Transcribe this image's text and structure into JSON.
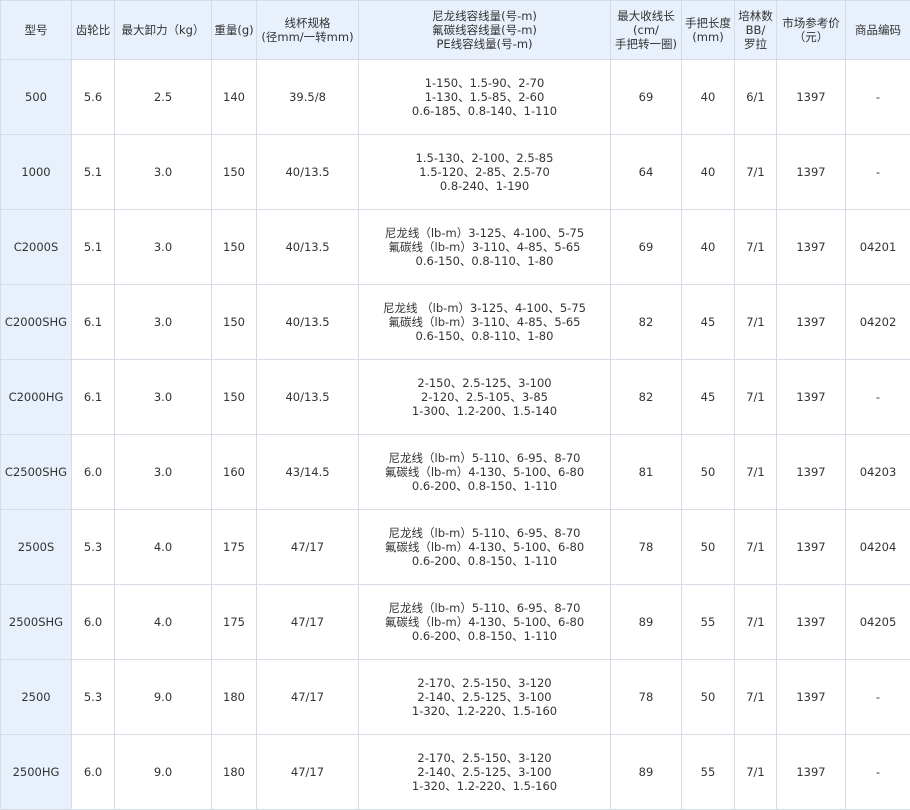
{
  "headers": [
    {
      "lines": [
        "型号"
      ]
    },
    {
      "lines": [
        "齿轮比"
      ]
    },
    {
      "lines": [
        "最大卸力（kg）"
      ]
    },
    {
      "lines": [
        "重量(g)"
      ]
    },
    {
      "lines": [
        "线杯规格",
        "(径mm/一转mm)"
      ]
    },
    {
      "lines": [
        "尼龙线容线量(号-m)",
        "氟碳线容线量(号-m)",
        "PE线容线量(号-m)"
      ]
    },
    {
      "lines": [
        "最大收线长",
        "(cm/",
        "手把转一圈)"
      ]
    },
    {
      "lines": [
        "手把长度",
        "(mm)"
      ]
    },
    {
      "lines": [
        "培林数",
        "BB/",
        "罗拉"
      ]
    },
    {
      "lines": [
        "市场参考价",
        "（元）"
      ]
    },
    {
      "lines": [
        "商品编码"
      ]
    }
  ],
  "rows": [
    {
      "model": "500",
      "gear_ratio": "5.6",
      "max_drag": "2.5",
      "weight": "140",
      "spool": "39.5/8",
      "capacity": [
        "1-150、1.5-90、2-70",
        "1-130、1.5-85、2-60",
        "0.6-185、0.8-140、1-110"
      ],
      "retrieve": "69",
      "handle": "40",
      "bearings": "6/1",
      "price": "1397",
      "code": "-"
    },
    {
      "model": "1000",
      "gear_ratio": "5.1",
      "max_drag": "3.0",
      "weight": "150",
      "spool": "40/13.5",
      "capacity": [
        "1.5-130、2-100、2.5-85",
        "1.5-120、2-85、2.5-70",
        "0.8-240、1-190"
      ],
      "retrieve": "64",
      "handle": "40",
      "bearings": "7/1",
      "price": "1397",
      "code": "-"
    },
    {
      "model": "C2000S",
      "gear_ratio": "5.1",
      "max_drag": "3.0",
      "weight": "150",
      "spool": "40/13.5",
      "capacity": [
        "尼龙线（lb-m）3-125、4-100、5-75",
        "氟碳线（lb-m）3-110、4-85、5-65",
        "0.6-150、0.8-110、1-80"
      ],
      "retrieve": "69",
      "handle": "40",
      "bearings": "7/1",
      "price": "1397",
      "code": "04201"
    },
    {
      "model": "C2000SHG",
      "gear_ratio": "6.1",
      "max_drag": "3.0",
      "weight": "150",
      "spool": "40/13.5",
      "capacity": [
        "尼龙线 （lb-m）3-125、4-100、5-75",
        "氟碳线（lb-m）3-110、4-85、5-65",
        "0.6-150、0.8-110、1-80"
      ],
      "retrieve": "82",
      "handle": "45",
      "bearings": "7/1",
      "price": "1397",
      "code": "04202"
    },
    {
      "model": "C2000HG",
      "gear_ratio": "6.1",
      "max_drag": "3.0",
      "weight": "150",
      "spool": "40/13.5",
      "capacity": [
        "2-150、2.5-125、3-100",
        "2-120、2.5-105、3-85",
        "1-300、1.2-200、1.5-140"
      ],
      "retrieve": "82",
      "handle": "45",
      "bearings": "7/1",
      "price": "1397",
      "code": "-"
    },
    {
      "model": "C2500SHG",
      "gear_ratio": "6.0",
      "max_drag": "3.0",
      "weight": "160",
      "spool": "43/14.5",
      "capacity": [
        "尼龙线（lb-m）5-110、6-95、8-70",
        "氟碳线（lb-m）4-130、5-100、6-80",
        "0.6-200、0.8-150、1-110"
      ],
      "retrieve": "81",
      "handle": "50",
      "bearings": "7/1",
      "price": "1397",
      "code": "04203"
    },
    {
      "model": "2500S",
      "gear_ratio": "5.3",
      "max_drag": "4.0",
      "weight": "175",
      "spool": "47/17",
      "capacity": [
        "尼龙线（lb-m）5-110、6-95、8-70",
        "氟碳线（lb-m）4-130、5-100、6-80",
        "0.6-200、0.8-150、1-110"
      ],
      "retrieve": "78",
      "handle": "50",
      "bearings": "7/1",
      "price": "1397",
      "code": "04204"
    },
    {
      "model": "2500SHG",
      "gear_ratio": "6.0",
      "max_drag": "4.0",
      "weight": "175",
      "spool": "47/17",
      "capacity": [
        "尼龙线（lb-m）5-110、6-95、8-70",
        "氟碳线（lb-m）4-130、5-100、6-80",
        "0.6-200、0.8-150、1-110"
      ],
      "retrieve": "89",
      "handle": "55",
      "bearings": "7/1",
      "price": "1397",
      "code": "04205"
    },
    {
      "model": "2500",
      "gear_ratio": "5.3",
      "max_drag": "9.0",
      "weight": "180",
      "spool": "47/17",
      "capacity": [
        "2-170、2.5-150、3-120",
        "2-140、2.5-125、3-100",
        "1-320、1.2-220、1.5-160"
      ],
      "retrieve": "78",
      "handle": "50",
      "bearings": "7/1",
      "price": "1397",
      "code": "-"
    },
    {
      "model": "2500HG",
      "gear_ratio": "6.0",
      "max_drag": "9.0",
      "weight": "180",
      "spool": "47/17",
      "capacity": [
        "2-170、2.5-150、3-120",
        "2-140、2.5-125、3-100",
        "1-320、1.2-220、1.5-160"
      ],
      "retrieve": "89",
      "handle": "55",
      "bearings": "7/1",
      "price": "1397",
      "code": "-"
    }
  ]
}
